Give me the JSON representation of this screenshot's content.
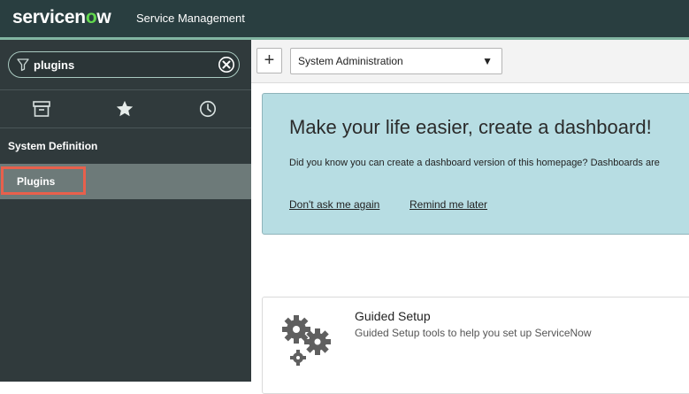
{
  "header": {
    "logo_text_pre": "servicen",
    "logo_text_o": "o",
    "logo_text_post": "w",
    "product_name": "Service Management"
  },
  "sidebar": {
    "search": {
      "value": "plugins",
      "placeholder": ""
    },
    "tabs": [
      {
        "icon": "archive-icon"
      },
      {
        "icon": "star-icon"
      },
      {
        "icon": "history-clock-icon"
      }
    ],
    "section": "System Definition",
    "modules": [
      {
        "label": "Plugins"
      }
    ]
  },
  "toolbar": {
    "add_label": "+",
    "dashboard_select": "System Administration",
    "caret": "▼"
  },
  "banner": {
    "title": "Make your life easier, create a dashboard!",
    "text": "Did you know you can create a dashboard version of this homepage? Dashboards are",
    "link_dont_ask": "Don't ask me again",
    "link_remind": "Remind me later"
  },
  "card": {
    "title": "Guided Setup",
    "description": "Guided Setup tools to help you set up ServiceNow",
    "icon": "gears-icon"
  },
  "colors": {
    "header_bg": "#293e40",
    "sidebar_bg": "#303a3c",
    "banner_bg": "#b7dde3",
    "highlight": "#e8604c"
  }
}
